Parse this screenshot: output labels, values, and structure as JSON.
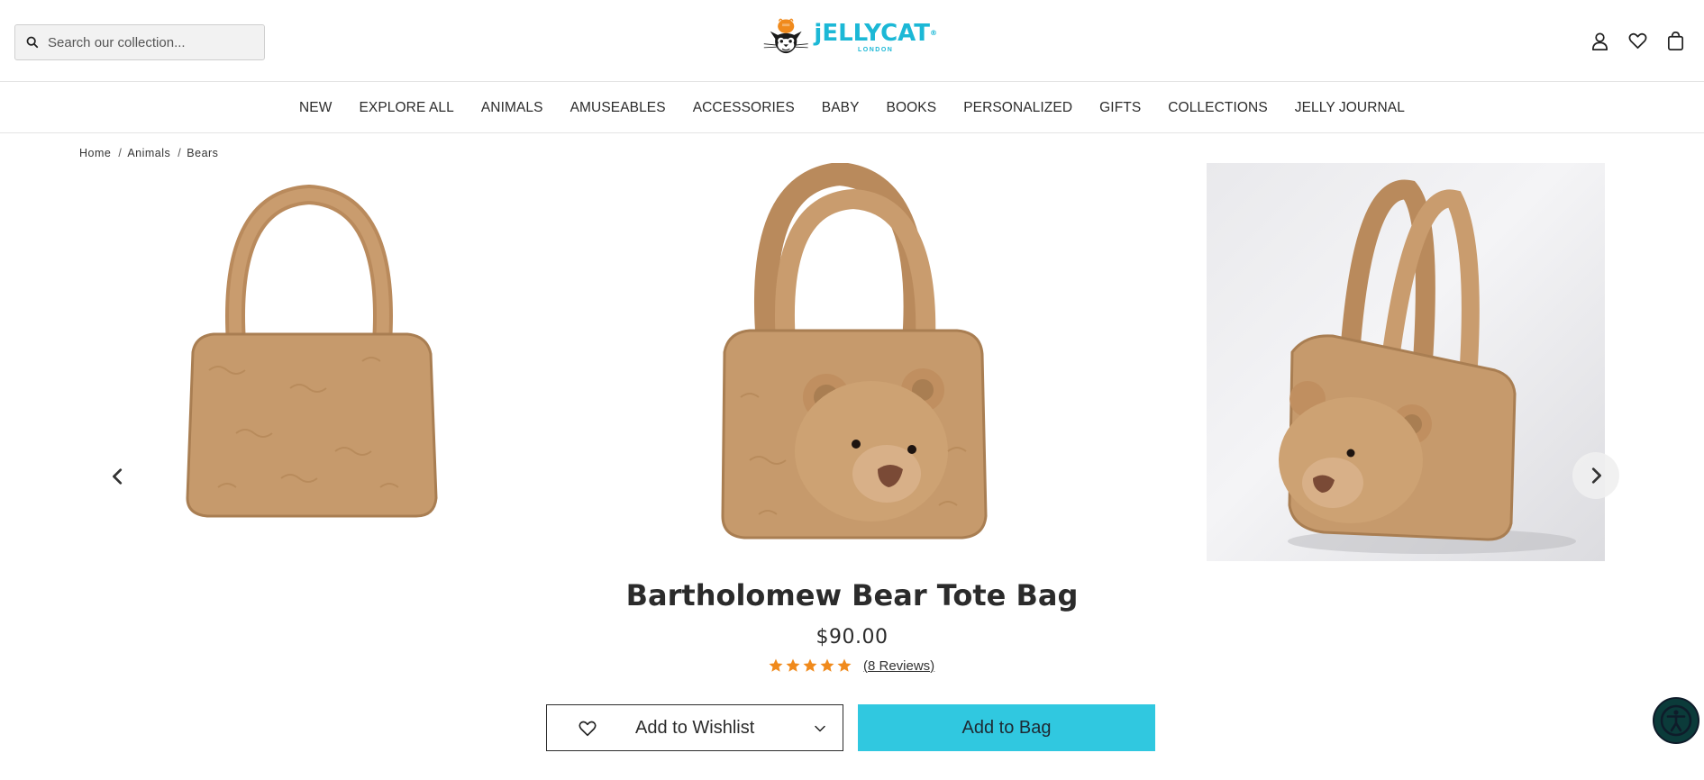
{
  "search": {
    "placeholder": "Search our collection..."
  },
  "logo": {
    "brand": "jELLYCAT",
    "city": "LONDON",
    "mark": "®"
  },
  "header_icons": [
    "account-icon",
    "wishlist-heart-icon",
    "shopping-bag-icon"
  ],
  "nav": {
    "items": [
      {
        "label": "NEW"
      },
      {
        "label": "EXPLORE ALL"
      },
      {
        "label": "ANIMALS"
      },
      {
        "label": "AMUSEABLES"
      },
      {
        "label": "ACCESSORIES"
      },
      {
        "label": "BABY"
      },
      {
        "label": "BOOKS"
      },
      {
        "label": "PERSONALIZED"
      },
      {
        "label": "GIFTS"
      },
      {
        "label": "COLLECTIONS"
      },
      {
        "label": "JELLY JOURNAL"
      }
    ]
  },
  "breadcrumb": {
    "separator": "/",
    "items": [
      {
        "label": "Home"
      },
      {
        "label": "Animals"
      },
      {
        "label": "Bears"
      }
    ]
  },
  "product": {
    "title": "Bartholomew Bear Tote Bag",
    "price": "$90.00",
    "rating": 5,
    "rating_max": 5,
    "reviews_label": "(8 Reviews)",
    "wishlist_label": "Add to Wishlist",
    "add_to_bag_label": "Add to Bag"
  },
  "colors": {
    "accent": "#30c8e0",
    "brand": "#1cb8d6",
    "star": "#f08a1c",
    "bag_fur": "#c69a6c"
  }
}
